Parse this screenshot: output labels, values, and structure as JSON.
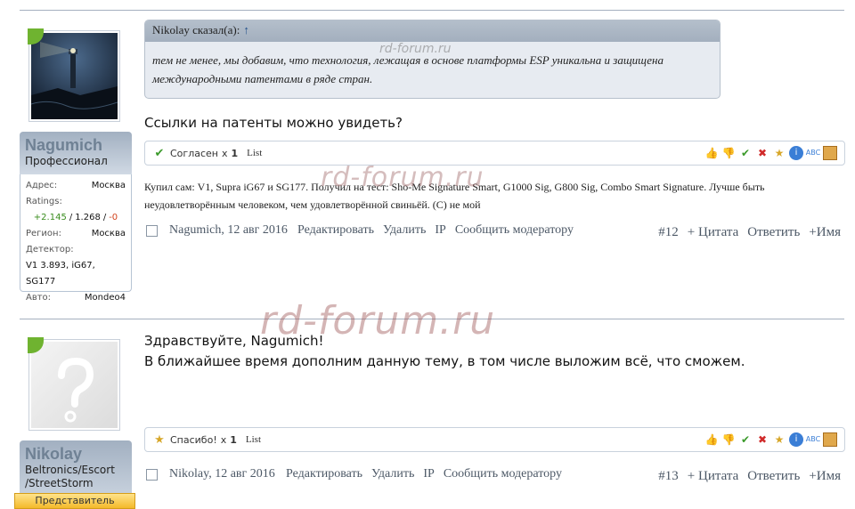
{
  "post1": {
    "user": {
      "name": "Nagumich",
      "title": "Профессионал",
      "info": [
        {
          "label": "Адрес:",
          "value": "Москва"
        },
        {
          "label": "Ratings:",
          "value": ""
        },
        {
          "label": "Регион:",
          "value": "Москва"
        },
        {
          "label": "Детектор:",
          "value": ""
        },
        {
          "label": "Авто:",
          "value": "Mondeo4"
        }
      ],
      "ratings": {
        "pos": "+2.145",
        "sep1": "/",
        "mid": "1.268",
        "sep2": "/",
        "neg": "-0"
      },
      "detector_value": "V1 3.893, iG67, SG177"
    },
    "quote": {
      "author": "Nikolay сказал(а):",
      "arrow": "↑",
      "text": "тем не менее, мы добавим, что технология, лежащая в основе платформы ESP уникальна и защищена международными патентами в ряде стран."
    },
    "message": "Ссылки на патенты можно увидеть?",
    "likes": {
      "label": "Согласен",
      "times": "x",
      "count": "1",
      "list": "List"
    },
    "signature": "Купил сам: V1, Supra iG67 и SG177. Получил на тест: Sho-Me Signature Smart, G1000 Sig, G800 Sig, Combo Smart Signature. Лучше быть неудовлетворённым человеком, чем удовлетворённой свиньёй. (С) не мой",
    "footer": {
      "meta": "Nagumich, 12 авг 2016",
      "edit": "Редактировать",
      "delete": "Удалить",
      "ip": "IP",
      "report": "Сообщить модератору",
      "num": "#12",
      "quote": "+ Цитата",
      "reply": "Ответить",
      "name": "+Имя"
    }
  },
  "post2": {
    "user": {
      "name": "Nikolay",
      "title": "Beltronics/Escort /StreetStorm",
      "badge": "Представитель"
    },
    "message_line1": "Здравствуйте, Nagumich!",
    "message_line2": "В ближайшее время дополним данную тему, в том числе выложим всё, что сможем.",
    "likes": {
      "label": "Спасибо!",
      "times": "x",
      "count": "1",
      "list": "List"
    },
    "footer": {
      "meta": "Nikolay, 12 авг 2016",
      "edit": "Редактировать",
      "delete": "Удалить",
      "ip": "IP",
      "report": "Сообщить модератору",
      "num": "#13",
      "quote": "+ Цитата",
      "reply": "Ответить",
      "name": "+Имя"
    }
  },
  "watermarks": {
    "small": "rd-forum.ru",
    "large": "rd-forum.ru",
    "mid": "rd-forum.ru"
  },
  "colors": {
    "accent_link": "#24528c",
    "online": "#6fb330",
    "name_color": "#6f8194"
  }
}
